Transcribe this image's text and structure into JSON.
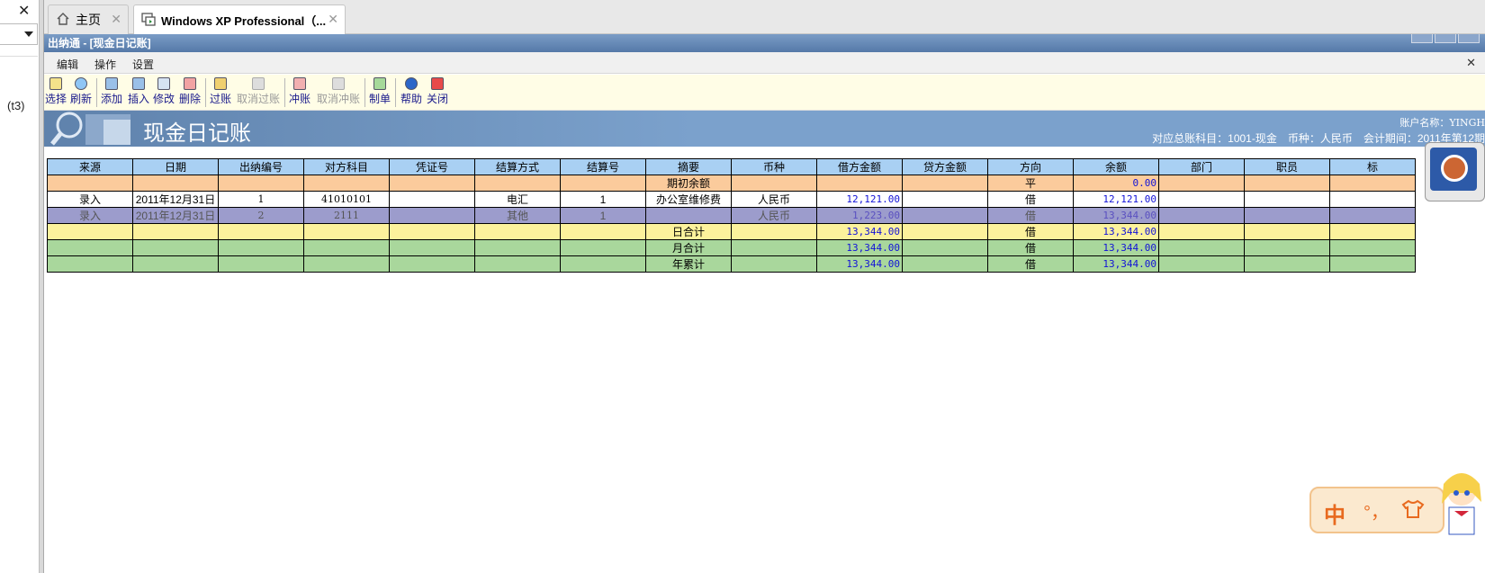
{
  "host": {
    "close_glyph": "✕",
    "sidebar_label": "(t3)"
  },
  "browser": {
    "tabs": [
      {
        "label": "主页",
        "icon": "home-icon"
      },
      {
        "label": "Windows XP Professional（...",
        "icon": "vm-icon"
      }
    ],
    "tab_close_glyph": "✕"
  },
  "app": {
    "title": "出纳通 - [现金日记账]",
    "menu": [
      "编辑",
      "操作",
      "设置"
    ],
    "menu_close": "✕",
    "toolbar": [
      {
        "label": "选择",
        "enabled": true,
        "icon": "select-icon"
      },
      {
        "label": "刷新",
        "enabled": true,
        "icon": "refresh-icon"
      },
      {
        "label": "添加",
        "enabled": true,
        "icon": "add-icon"
      },
      {
        "label": "插入",
        "enabled": true,
        "icon": "insert-icon"
      },
      {
        "label": "修改",
        "enabled": true,
        "icon": "edit-icon"
      },
      {
        "label": "删除",
        "enabled": true,
        "icon": "delete-icon"
      },
      {
        "label": "过账",
        "enabled": true,
        "icon": "post-icon"
      },
      {
        "label": "取消过账",
        "enabled": false,
        "icon": "unpost-icon"
      },
      {
        "label": "冲账",
        "enabled": true,
        "icon": "reverse-icon"
      },
      {
        "label": "取消冲账",
        "enabled": false,
        "icon": "unreverse-icon"
      },
      {
        "label": "制单",
        "enabled": true,
        "icon": "voucher-icon"
      },
      {
        "label": "帮助",
        "enabled": true,
        "icon": "help-icon"
      },
      {
        "label": "关闭",
        "enabled": true,
        "icon": "close-icon"
      }
    ],
    "banner": {
      "title": "现金日记账",
      "info_line1": "账户名称：YINGH",
      "info_line2": "对应总账科目：1001-现金　币种：人民币　会计期间：2011年第12期"
    },
    "table": {
      "headers": [
        "来源",
        "日期",
        "出纳编号",
        "对方科目",
        "凭证号",
        "结算方式",
        "结算号",
        "摘要",
        "币种",
        "借方金额",
        "贷方金额",
        "方向",
        "余额",
        "部门",
        "职员",
        "标"
      ],
      "rows": [
        {
          "type": "open",
          "cells": [
            "",
            "",
            "",
            "",
            "",
            "",
            "",
            "期初余额",
            "",
            "",
            "",
            "平",
            "0.00",
            "",
            "",
            ""
          ]
        },
        {
          "type": "normal",
          "cells": [
            "录入",
            "2011年12月31日",
            "1",
            "41010101",
            "",
            "电汇",
            "1",
            "办公室维修费",
            "人民币",
            "12,121.00",
            "",
            "借",
            "12,121.00",
            "",
            "",
            ""
          ]
        },
        {
          "type": "sel",
          "cells": [
            "录入",
            "2011年12月31日",
            "2",
            "2111",
            "",
            "其他",
            "1",
            "",
            "人民币",
            "1,223.00",
            "",
            "借",
            "13,344.00",
            "",
            "",
            ""
          ]
        },
        {
          "type": "day",
          "cells": [
            "",
            "",
            "",
            "",
            "",
            "",
            "",
            "日合计",
            "",
            "13,344.00",
            "",
            "借",
            "13,344.00",
            "",
            "",
            ""
          ]
        },
        {
          "type": "month",
          "cells": [
            "",
            "",
            "",
            "",
            "",
            "",
            "",
            "月合计",
            "",
            "13,344.00",
            "",
            "借",
            "13,344.00",
            "",
            "",
            ""
          ]
        },
        {
          "type": "year",
          "cells": [
            "",
            "",
            "",
            "",
            "",
            "",
            "",
            "年累计",
            "",
            "13,344.00",
            "",
            "借",
            "13,344.00",
            "",
            "",
            ""
          ]
        }
      ]
    }
  },
  "ime": {
    "mode": "中",
    "punct": "°，",
    "skin_icon": "shirt-icon"
  },
  "colors": {
    "header": "#a9d0f3",
    "open_row": "#fbcb9c",
    "selected_row": "#9c9ccc",
    "day_row": "#fcf29c",
    "total_row": "#a9d79c",
    "amount_text": "#1212d8"
  }
}
